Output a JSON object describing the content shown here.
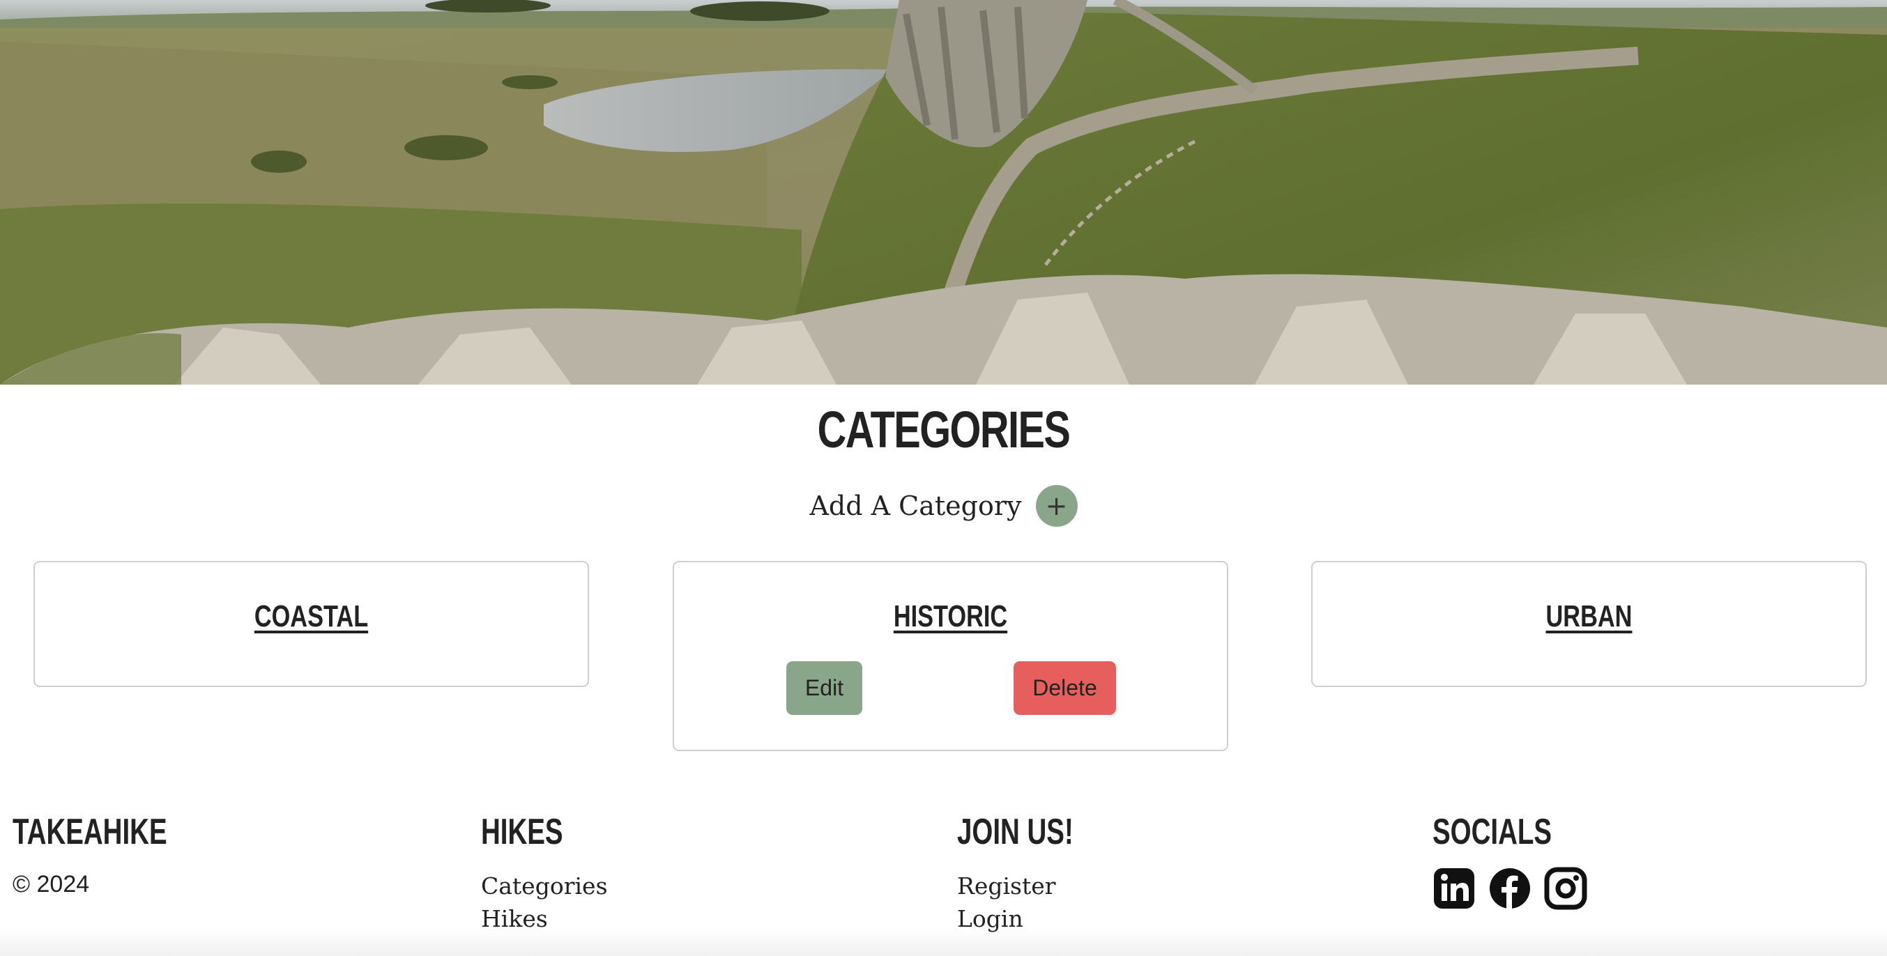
{
  "hero": {
    "image": "hadrians-wall-landscape"
  },
  "categories": {
    "title": "CATEGORIES",
    "add_label": "Add A Category",
    "add_icon": "+",
    "items": [
      {
        "name": "COASTAL"
      },
      {
        "name": "HISTORIC",
        "edit_label": "Edit",
        "delete_label": "Delete"
      },
      {
        "name": "URBAN"
      }
    ]
  },
  "footer": {
    "brand": {
      "title": "TAKEAHIKE",
      "copyright": "© 2024"
    },
    "hikes": {
      "title": "HIKES",
      "links": [
        "Categories",
        "Hikes"
      ]
    },
    "join": {
      "title": "JOIN US!",
      "links": [
        "Register",
        "Login"
      ]
    },
    "socials": {
      "title": "SOCIALS",
      "icons": [
        "linkedin-icon",
        "facebook-icon",
        "instagram-icon"
      ]
    }
  },
  "colors": {
    "accent_green": "#8aa68a",
    "danger_red": "#e65f5c",
    "text": "#222222"
  }
}
